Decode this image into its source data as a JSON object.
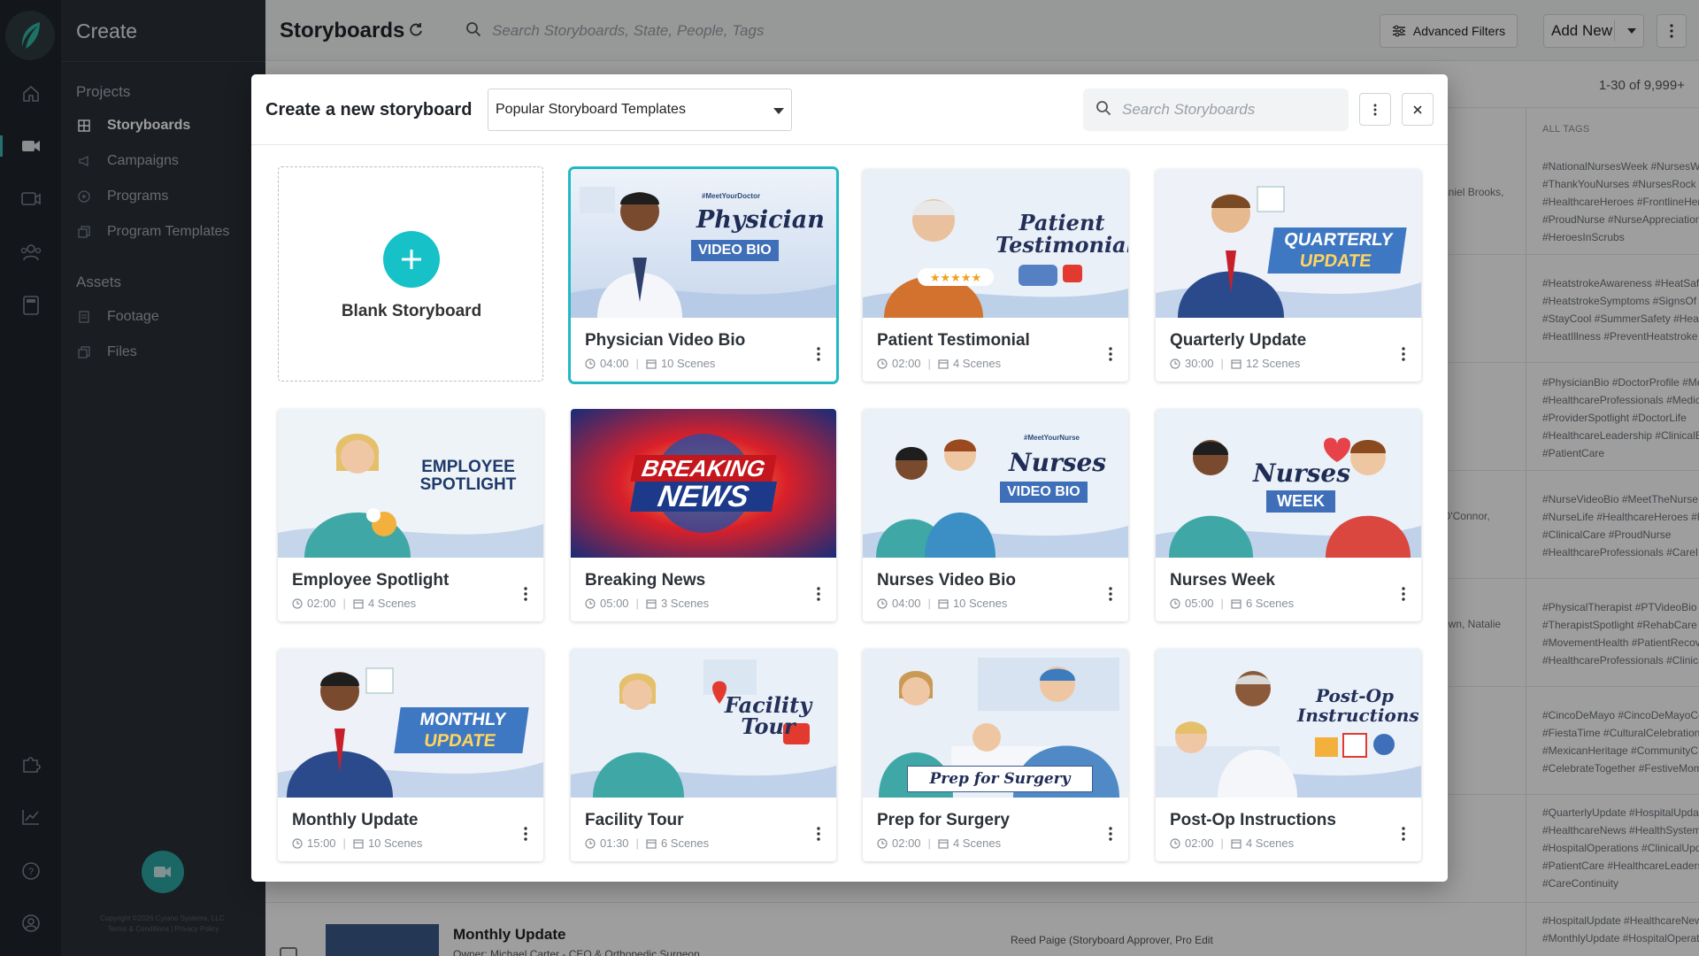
{
  "app": {
    "name": "Create"
  },
  "nav": {
    "sections": [
      {
        "label": "Projects"
      },
      {
        "label": "Assets"
      }
    ],
    "projects": [
      {
        "label": "Storyboards",
        "active": true
      },
      {
        "label": "Campaigns"
      },
      {
        "label": "Programs"
      },
      {
        "label": "Program Templates"
      }
    ],
    "assets": [
      {
        "label": "Footage"
      },
      {
        "label": "Files"
      }
    ],
    "copyright_line1": "Copyright ©2026 Cyrano Systems, LLC.",
    "copyright_line2": "Terms & Conditions | Privacy Policy"
  },
  "topbar": {
    "title": "Storyboards",
    "search_placeholder": "Search Storyboards, State, People, Tags",
    "advanced_filters": "Advanced Filters",
    "add_new": "Add New"
  },
  "list": {
    "count": "1-30 of 9,999+",
    "tags_header": "ALL TAGS",
    "tag_blocks": [
      [
        "#NationalNursesWeek #NursesWe",
        "#ThankYouNurses #NursesRock #",
        "#HealthcareHeroes #FrontlineHer",
        "#ProudNurse #NurseAppreciation",
        "#HeroesInScrubs"
      ],
      [
        "#HeatstrokeAwareness #HeatSafe",
        "#HeatstrokeSymptoms #SignsOf",
        "#StayCool #SummerSafety #Heal",
        "#HeatIllness #PreventHeatstroke"
      ],
      [
        "#PhysicianBio #DoctorProfile #Me",
        "#HealthcareProfessionals #Medic",
        "#ProviderSpotlight #DoctorLife",
        "#HealthcareLeadership #ClinicalE",
        "#PatientCare"
      ],
      [
        "#NurseVideoBio #MeetTheNurse",
        "#NurseLife #HealthcareHeroes #F",
        "#ClinicalCare #ProudNurse",
        "#HealthcareProfessionals #CareIn"
      ],
      [
        "#PhysicalTherapist #PTVideoBio",
        "#TherapistSpotlight #RehabCare",
        "#MovementHealth #PatientRecov",
        "#HealthcareProfessionals #Clinica"
      ],
      [
        "#CincoDeMayo #CincoDeMayoCe",
        "#FiestaTime #CulturalCelebration",
        "#MexicanHeritage #CommunityC",
        "#CelebrateTogether #FestiveMom"
      ],
      [
        "#QuarterlyUpdate #HospitalUpda",
        "#HealthcareNews #HealthSystem",
        "#HospitalOperations #ClinicalUpd",
        "#PatientCare #HealthcareLeaders",
        "#CareContinuity"
      ],
      [
        "#HospitalUpdate #HealthcareNew",
        "#MonthlyUpdate #HospitalOperat"
      ]
    ],
    "people_fragments": [
      "aniel Brooks,",
      "O'Connor,",
      "own, Natalie"
    ],
    "bottom_row": {
      "title": "Monthly Update",
      "owner": "Owner: Michael Carter - CEO & Orthopedic Surgeon",
      "approvers": "Reed Paige (Storyboard Approver, Pro Edit"
    }
  },
  "modal": {
    "title": "Create a new storyboard",
    "template_select": "Popular Storyboard Templates",
    "search_placeholder": "Search Storyboards",
    "blank_label": "Blank Storyboard",
    "templates": [
      {
        "title": "Physician Video Bio",
        "duration": "04:00",
        "scenes": "10 Scenes",
        "selected": true,
        "overlay": [
          "#MeetYourDoctor",
          "Physician",
          "VIDEO BIO"
        ]
      },
      {
        "title": "Patient Testimonial",
        "duration": "02:00",
        "scenes": "4 Scenes",
        "overlay": [
          "Patient",
          "Testimonial"
        ]
      },
      {
        "title": "Quarterly Update",
        "duration": "30:00",
        "scenes": "12 Scenes",
        "overlay": [
          "QUARTERLY",
          "UPDATE"
        ]
      },
      {
        "title": "Employee Spotlight",
        "duration": "02:00",
        "scenes": "4 Scenes",
        "overlay": [
          "EMPLOYEE",
          "SPOTLIGHT"
        ]
      },
      {
        "title": "Breaking News",
        "duration": "05:00",
        "scenes": "3 Scenes",
        "overlay": [
          "BREAKING",
          "NEWS"
        ]
      },
      {
        "title": "Nurses Video Bio",
        "duration": "04:00",
        "scenes": "10 Scenes",
        "overlay": [
          "#MeetYourNurse",
          "Nurses",
          "VIDEO BIO"
        ]
      },
      {
        "title": "Nurses Week",
        "duration": "05:00",
        "scenes": "6 Scenes",
        "overlay": [
          "Nurses",
          "WEEK"
        ]
      },
      {
        "title": "Monthly Update",
        "duration": "15:00",
        "scenes": "10 Scenes",
        "overlay": [
          "MONTHLY",
          "UPDATE"
        ]
      },
      {
        "title": "Facility Tour",
        "duration": "01:30",
        "scenes": "6 Scenes",
        "overlay": [
          "Facility",
          "Tour"
        ]
      },
      {
        "title": "Prep for Surgery",
        "duration": "02:00",
        "scenes": "4 Scenes",
        "overlay": [
          "Prep for Surgery"
        ]
      },
      {
        "title": "Post-Op Instructions",
        "duration": "02:00",
        "scenes": "4 Scenes",
        "overlay": [
          "Post-Op",
          "Instructions"
        ]
      }
    ]
  },
  "colors": {
    "accent": "#16c2c8",
    "rail": "#1f252d",
    "nav": "#2a3038",
    "selected_border": "#22b8c4"
  }
}
